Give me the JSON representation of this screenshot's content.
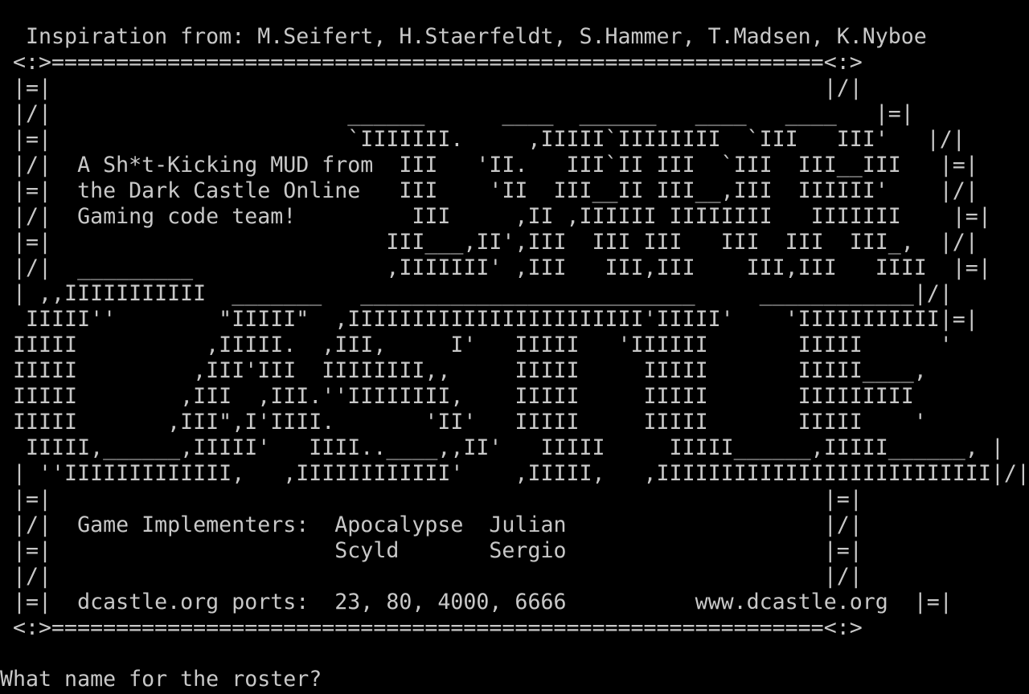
{
  "screen": {
    "lines": [
      "  Inspiration from: M.Seifert, H.Staerfeldt, S.Hammer, T.Madsen, K.Nyboe",
      " <:>============================================================<:>",
      " |=|                                                            |/|",
      " |/|                       ______      ____  ______   ____   ____   |=|",
      " |=|                       `IIIIIII.     ,IIIII`IIIIIIII  `III   III'   |/|",
      " |/|  A Sh*t-Kicking MUD from  III   'II.   III`II III  `III  III__III   |=|",
      " |=|  the Dark Castle Online   III    'II  III__II III__,III  IIIIII'    |/|",
      " |/|  Gaming code team!         III     ,II ,IIIIII IIIIIIII   IIIIIII    |=|",
      " |=|                          III___,II',III  III III   III  III  III_,  |/|",
      " |/|  _________               ,IIIIIII' ,III   III,III    III,III   IIII  |=|",
      " | ,,IIIIIIIIIII  _______   __________________________     ____________|/|",
      "  IIIII''        \"IIIII\"  ,IIIIIIIIIIIIIIIIIIIIIII'IIIII'    'IIIIIIIIIII|=|",
      " IIIII          ,IIIII.  ,III,     I'   IIIII   'IIIIII       IIIII      '",
      " IIIII         ,III'III  IIIIIIII,,     IIIII     IIIII       IIIII____,",
      " IIIII        ,III  ,III.''IIIIIIII,    IIIII     IIIII       IIIIIIIII",
      " IIIII       ,III\",I'IIII.       'II'   IIIII     IIIII       IIIII    '",
      "  IIIII,______,IIIII'   IIII..____,,II'   IIIII     IIIII______,IIIII______, |",
      " | ''IIIIIIIIIIIII,   ,IIIIIIIIIIII'    ,IIIII,   ,IIIIIIIIIIIIIIIIIIIIIIIIII|/|",
      " |=|                                                            |=|",
      " |/|  Game Implementers:  Apocalypse  Julian                    |/|",
      " |=|                      Scyld       Sergio                    |=|",
      " |/|                                                            |/|",
      " |=|  dcastle.org ports:  23, 80, 4000, 6666          www.dcastle.org  |=|",
      " <:>============================================================<:>"
    ],
    "prompt": "What name for the roster?",
    "input_value": ""
  },
  "colors": {
    "background": "#000000",
    "text": "#c8c8c8"
  }
}
